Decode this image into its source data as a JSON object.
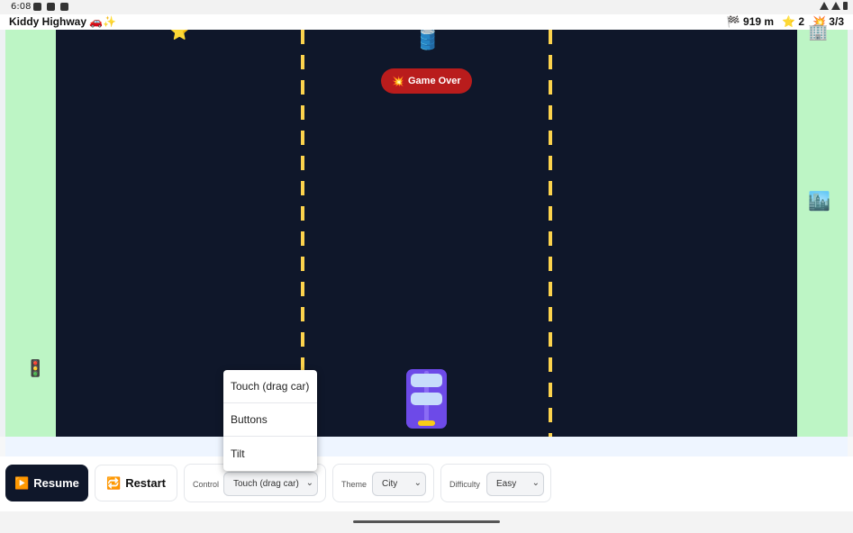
{
  "status_bar": {
    "time": "6:08"
  },
  "app": {
    "title": "Kiddy Highway 🚗✨"
  },
  "stats": {
    "distance": "🏁 919 m",
    "stars": "⭐ 2",
    "crashes": "💥 3/3"
  },
  "game": {
    "overlay": {
      "icon": "💥",
      "text": "Game Over"
    },
    "objects": {
      "star": "⭐",
      "barrel": "🛢️",
      "building_top": "🏢",
      "city": "🏙️",
      "traffic_light": "🚦"
    }
  },
  "controls": {
    "resume_icon": "▶️",
    "resume_label": "Resume",
    "restart_icon": "🔁",
    "restart_label": "Restart",
    "control_label": "Control",
    "control_value": "Touch (drag car)",
    "theme_label": "Theme",
    "theme_value": "City",
    "difficulty_label": "Difficulty",
    "difficulty_value": "Easy"
  },
  "dropdown": {
    "options": [
      "Touch (drag car)",
      "Buttons",
      "Tilt"
    ]
  },
  "colors": {
    "road": "#0f172a",
    "grass": "#bdf5c5",
    "lane": "#fcd34d",
    "car": "#6d4ae8",
    "game_over": "#b91c1c"
  }
}
